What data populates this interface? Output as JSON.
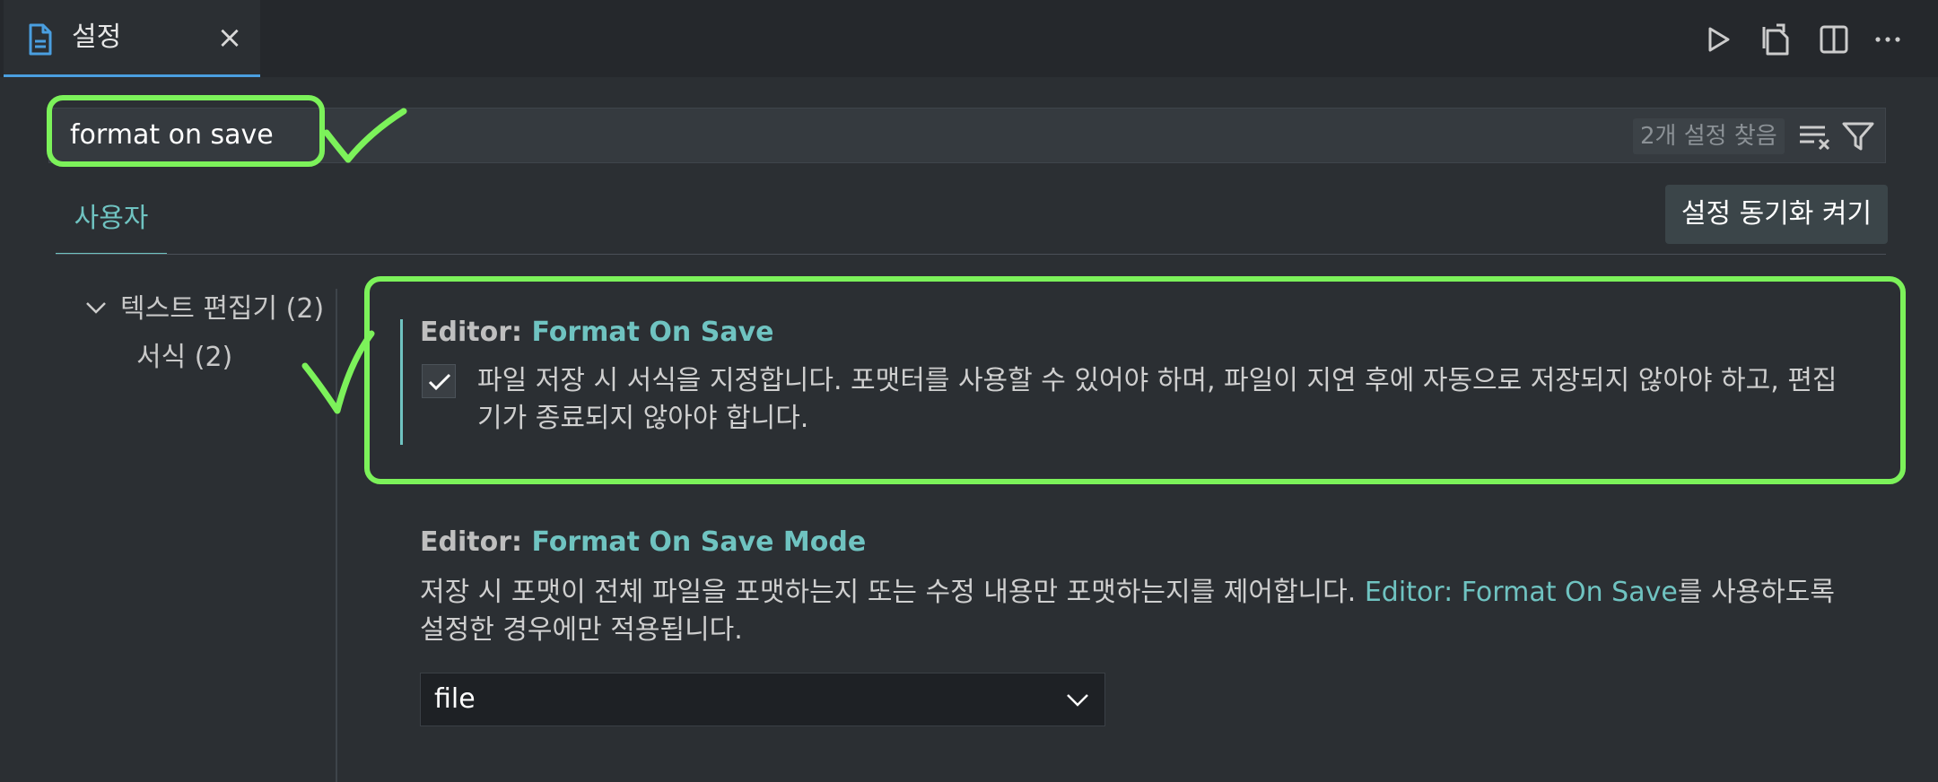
{
  "tab": {
    "title": "설정",
    "close": "×"
  },
  "toolbar": {
    "icons": [
      "run-icon",
      "open-json-icon",
      "split-editor-icon",
      "more-actions-icon"
    ]
  },
  "search": {
    "value": "format on save",
    "result_count": "2개 설정 찾음"
  },
  "scope": {
    "user_tab": "사용자",
    "sync_button": "설정 동기화 켜기"
  },
  "toc": {
    "group": "텍스트 편집기 (2)",
    "subgroup": "서식 (2)"
  },
  "settings": [
    {
      "category": "Editor: ",
      "name": "Format On Save",
      "checked": true,
      "description": "파일 저장 시 서식을 지정합니다. 포맷터를 사용할 수 있어야 하며, 파일이 지연 후에 자동으로 저장되지 않아야 하고, 편집기가 종료되지 않아야 합니다."
    },
    {
      "category": "Editor: ",
      "name": "Format On Save Mode",
      "description_pre": "저장 시 포맷이 전체 파일을 포맷하는지 또는 수정 내용만 포맷하는지를 제어합니다. ",
      "description_link": "Editor: Format On Save",
      "description_post": "를 사용하도록 설정한 경우에만 적용됩니다.",
      "select_value": "file"
    }
  ],
  "colors": {
    "accent": "#6fc3c1",
    "annotation": "#7cf25a",
    "tab_indicator": "#4a9fe0"
  }
}
